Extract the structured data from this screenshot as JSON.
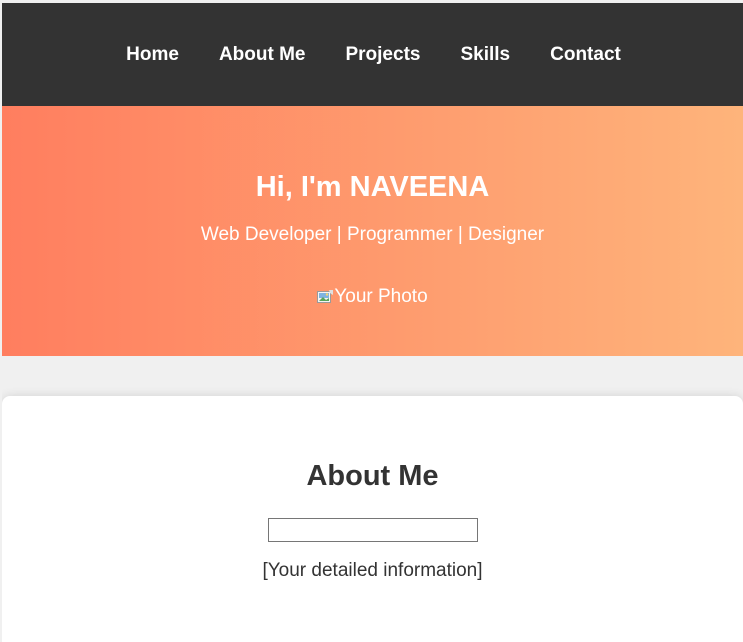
{
  "nav": {
    "items": [
      {
        "label": "Home"
      },
      {
        "label": "About Me"
      },
      {
        "label": "Projects"
      },
      {
        "label": "Skills"
      },
      {
        "label": "Contact"
      }
    ]
  },
  "hero": {
    "title": "Hi, I'm NAVEENA",
    "subtitle": "Web Developer | Programmer | Designer",
    "photo_alt": "Your Photo",
    "gradient": [
      "#ff7e5f",
      "#feb47b"
    ]
  },
  "about": {
    "title": "About Me",
    "text": "[Your detailed information]"
  },
  "colors": {
    "navbar": "#333333",
    "page_background": "#f0f0f0",
    "heading_text": "#333333"
  },
  "icons": {
    "broken_image": "broken-image-icon"
  }
}
